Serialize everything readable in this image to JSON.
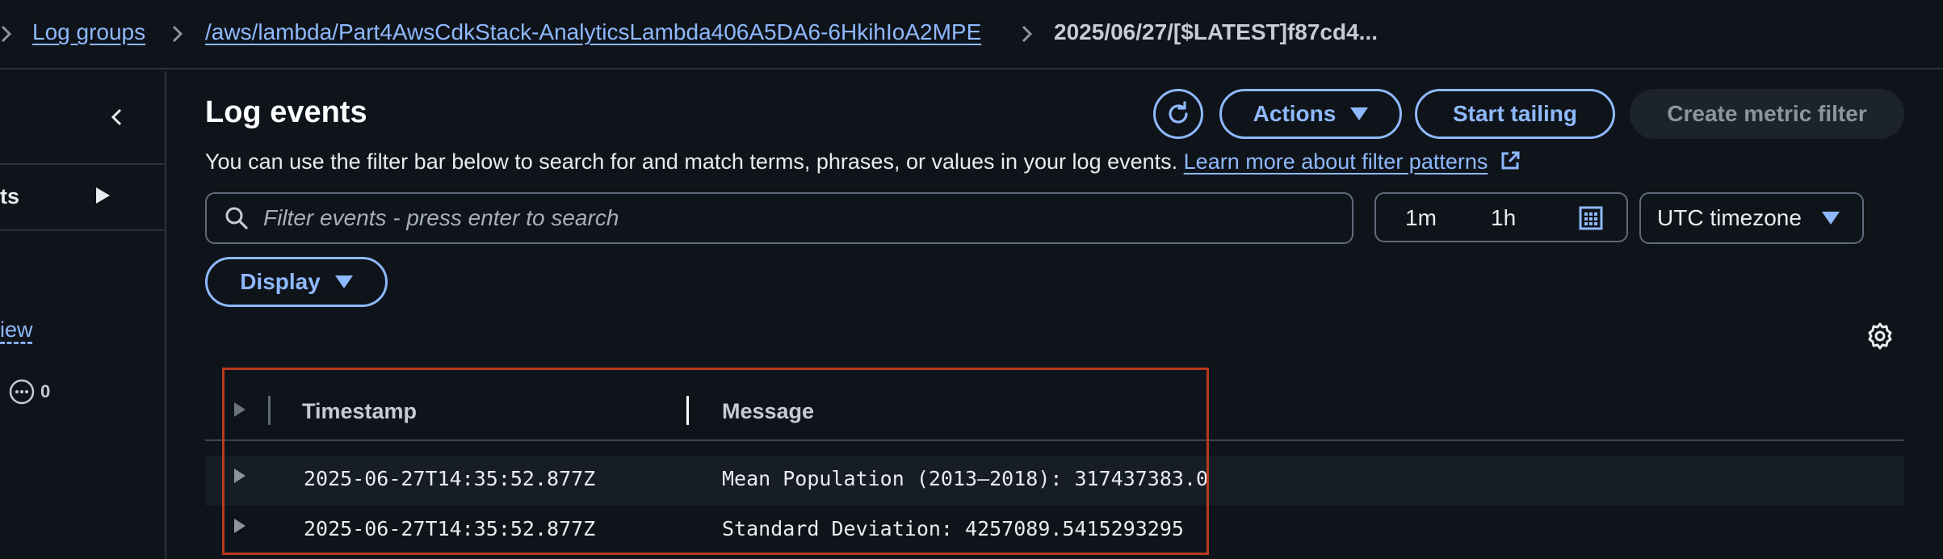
{
  "breadcrumb": {
    "log_groups": "Log groups",
    "log_group_name": "/aws/lambda/Part4AwsCdkStack-AnalyticsLambda406A5DA6-6HkihIoA2MPE",
    "stream_name": "2025/06/27/[$LATEST]f87cd4..."
  },
  "leftnav": {
    "item_label": "ts",
    "link_label": "iew",
    "count": "0"
  },
  "main": {
    "title": "Log events",
    "description": "You can use the filter bar below to search for and match terms, phrases, or values in your log events.",
    "learn_more": "Learn more about filter patterns",
    "actions_label": "Actions",
    "start_tailing_label": "Start tailing",
    "create_metric_filter_label": "Create metric filter",
    "search_placeholder": "Filter events - press enter to search",
    "range_1m": "1m",
    "range_1h": "1h",
    "timezone": "UTC timezone",
    "display_label": "Display"
  },
  "table": {
    "columns": [
      "Timestamp",
      "Message"
    ],
    "rows": [
      {
        "timestamp": "2025-06-27T14:35:52.877Z",
        "message": "Mean Population (2013–2018): 317437383.0"
      },
      {
        "timestamp": "2025-06-27T14:35:52.877Z",
        "message": "Standard Deviation: 4257089.5415293295"
      }
    ]
  },
  "colors": {
    "accent": "#8fb9ff",
    "background": "#0f141a",
    "highlight_border": "#b93a1d"
  }
}
